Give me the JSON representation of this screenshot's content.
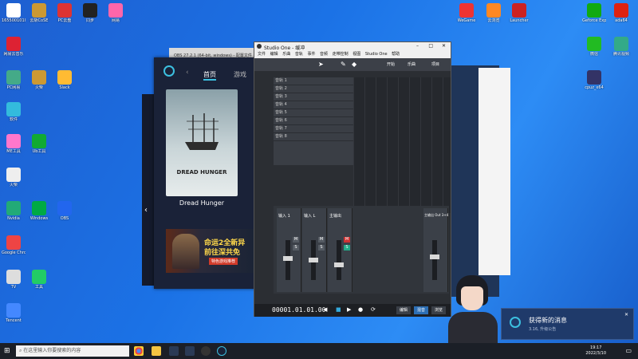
{
  "desktop": {
    "col1": [
      "1655001010",
      "网易云音乐",
      "PC网易",
      "软件",
      "ME工具",
      "火柴",
      "Nvidia",
      "Google Chrome",
      "TV",
      "Tencent"
    ],
    "col2": [
      "云斩CoSE",
      "火柴",
      "Ub工具",
      "Windows",
      "工具",
      "PC云盘",
      "Slack",
      "OBS",
      "同步",
      "网易"
    ],
    "top_right": [
      "WeGame",
      "云浏览",
      "Launcher",
      "Geforce Experience",
      "ada64"
    ],
    "right2": [
      "微信",
      "腾讯视频",
      "cpuz_x64"
    ]
  },
  "launcher": {
    "tab_home": "首页",
    "tab_games": "游戏",
    "game_title_art": "DREAD HUNGER",
    "game_name": "Dread Hunger",
    "banner_line1": "命运2全新异",
    "banner_line2": "前往深共免",
    "banner_tag": "特色游戏推荐"
  },
  "obs": {
    "title": "OBS 27.2.1 (64-bit, windows) - 配置文件"
  },
  "daw": {
    "title": "Studio One - 缓冲",
    "menu": [
      "文件",
      "编辑",
      "乐曲",
      "音轨",
      "事件",
      "音频",
      "走带控制",
      "视图",
      "Studio One",
      "帮助"
    ],
    "toolbar_labels": [
      "开始",
      "乐曲",
      "项目"
    ],
    "tracks": [
      "音轨 1",
      "音轨 2",
      "音轨 3",
      "音轨 4",
      "音轨 5",
      "音轨 6",
      "音轨 7",
      "音轨 8"
    ],
    "time": "00001.01.01.00",
    "bottom_buttons": [
      "编辑",
      "混音",
      "浏览"
    ],
    "strips": [
      "输入 1",
      "输入 L",
      "主输出",
      "主输出 Out 3+4"
    ]
  },
  "notification": {
    "title": "获得新的消息",
    "subtitle": "3.16, 升级公告"
  },
  "taskbar": {
    "search_placeholder": "在这里输入你要搜索的内容",
    "time": "19:17",
    "date": "2022/3/10"
  }
}
